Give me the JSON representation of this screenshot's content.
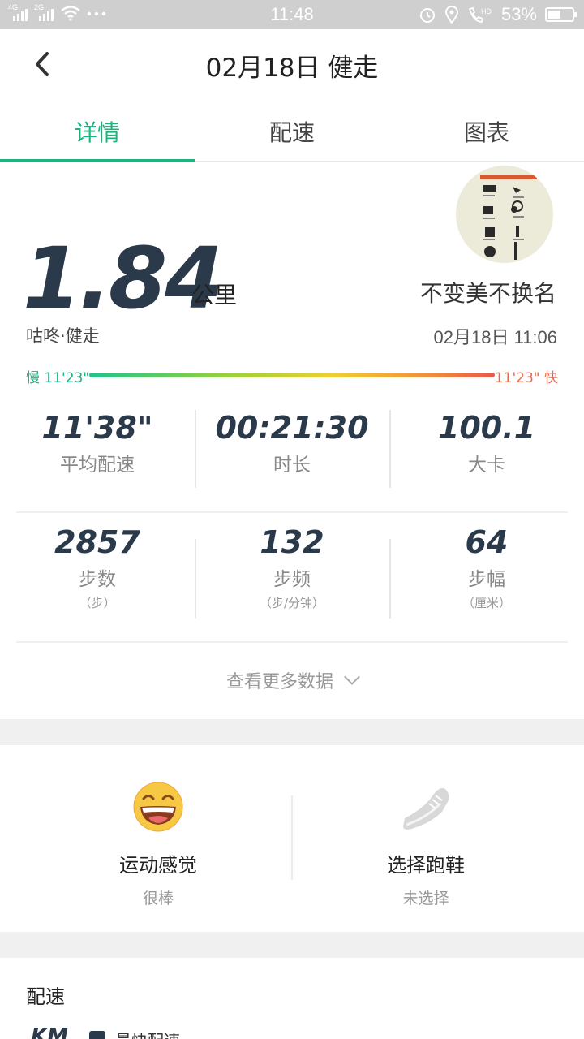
{
  "status_bar": {
    "sim1": "4G",
    "sim2": "2G",
    "time": "11:48",
    "battery_percent": "53%",
    "battery_level": 0.53,
    "icons": [
      "signal-icon",
      "wifi-icon",
      "more-dots-icon",
      "alarm-icon",
      "location-icon",
      "hd-call-icon",
      "battery-icon"
    ]
  },
  "header": {
    "title": "02月18日 健走"
  },
  "tabs": [
    {
      "label": "详情",
      "active": true
    },
    {
      "label": "配速",
      "active": false
    },
    {
      "label": "图表",
      "active": false
    }
  ],
  "summary": {
    "distance": "1.84",
    "unit": "公里",
    "sport_type": "咕咚·健走",
    "username": "不变美不换名",
    "datetime": "02月18日 11:06"
  },
  "pace_range": {
    "slow_label": "慢 11'23\"",
    "fast_label": "11'23\" 快"
  },
  "stats_row1": [
    {
      "value": "11'38\"",
      "label": "平均配速"
    },
    {
      "value": "00:21:30",
      "label": "时长"
    },
    {
      "value": "100.1",
      "label": "大卡"
    }
  ],
  "stats_row2": [
    {
      "value": "2857",
      "label": "步数",
      "unit": "（步）"
    },
    {
      "value": "132",
      "label": "步频",
      "unit": "（步/分钟）"
    },
    {
      "value": "64",
      "label": "步幅",
      "unit": "（厘米）"
    }
  ],
  "more_data": "查看更多数据",
  "feeling": {
    "title": "运动感觉",
    "value": "很棒"
  },
  "shoes": {
    "title": "选择跑鞋",
    "value": "未选择"
  },
  "pace_section": {
    "title": "配速",
    "axis_label": "KM",
    "legend": "最快配速"
  },
  "colors": {
    "accent": "#1db37d",
    "dark": "#2b3a4a",
    "fast": "#e66a4e"
  }
}
